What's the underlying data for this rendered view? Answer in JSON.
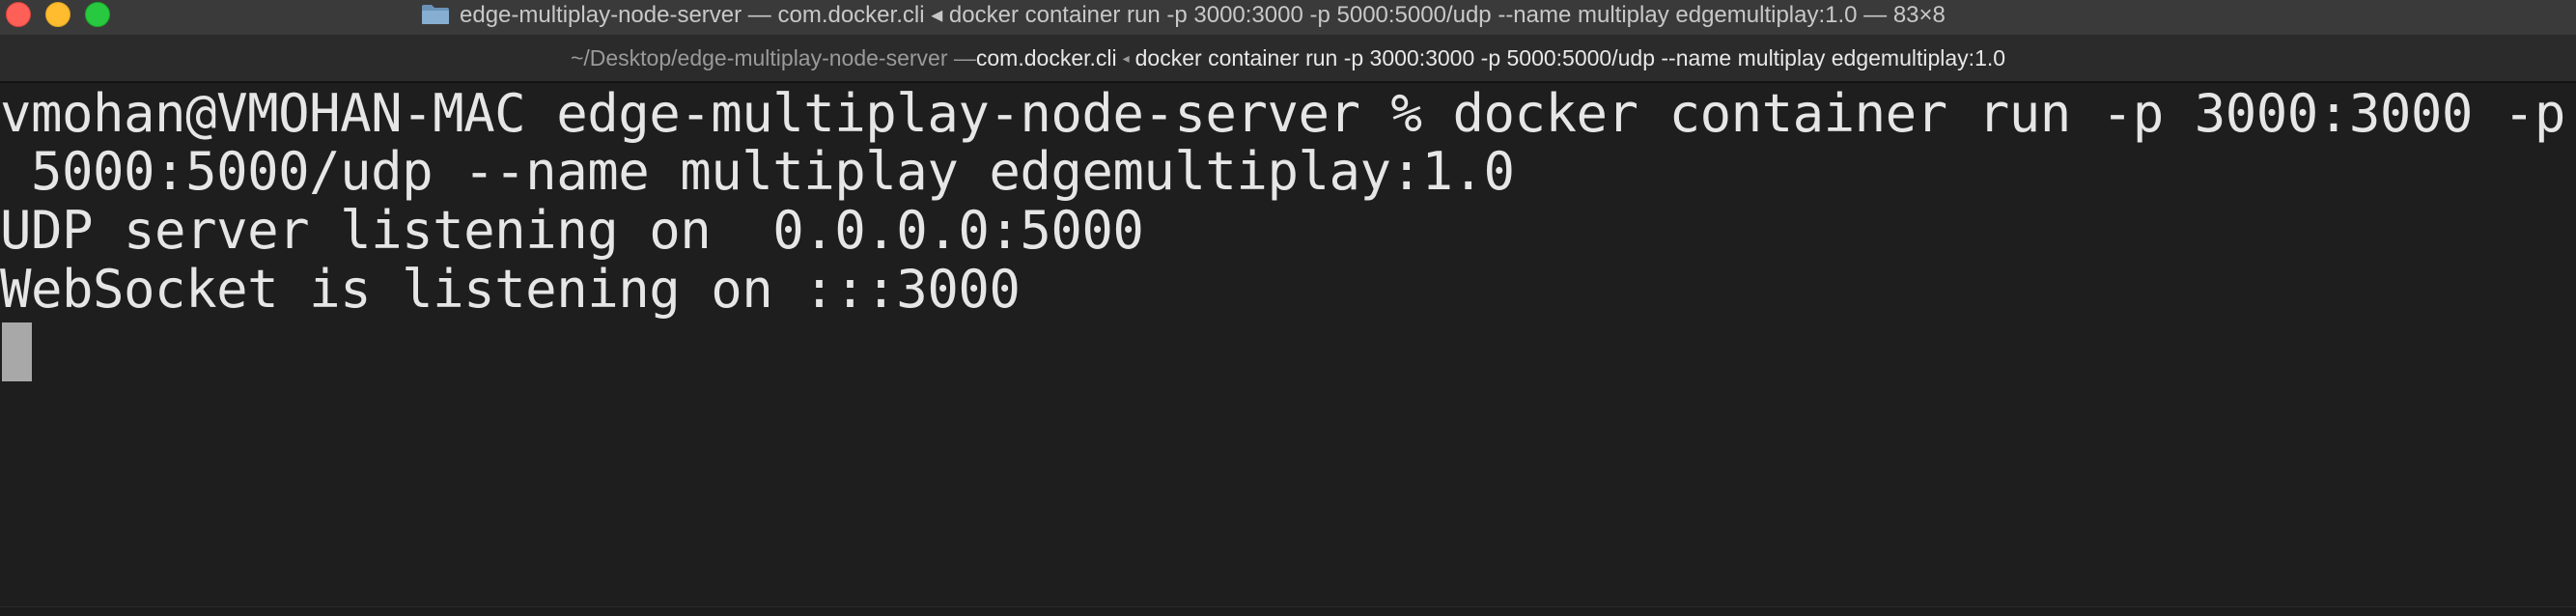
{
  "window": {
    "title": "edge-multiplay-node-server — com.docker.cli ◂ docker container run -p 3000:3000 -p 5000:5000/udp --name multiplay edgemultiplay:1.0 — 83×8",
    "icon": "folder-icon"
  },
  "tab": {
    "path": "~/Desktop/edge-multiplay-node-server — ",
    "process": "com.docker.cli",
    "arrow": "◂",
    "command": "docker container run -p 3000:3000 -p 5000:5000/udp --name multiplay edgemultiplay:1.0"
  },
  "terminal": {
    "lines": [
      "vmohan@VMOHAN-MAC edge-multiplay-node-server % docker container run -p 3000:3000 -p",
      " 5000:5000/udp --name multiplay edgemultiplay:1.0",
      "UDP server listening on  0.0.0.0:5000",
      "WebSocket is listening on :::3000"
    ]
  },
  "colors": {
    "background": "#1e1e1e",
    "text": "#e6e6e6",
    "cursor": "#a8a8a8",
    "close": "#fe5f57",
    "minimize": "#febc2e",
    "maximize": "#28c840"
  }
}
